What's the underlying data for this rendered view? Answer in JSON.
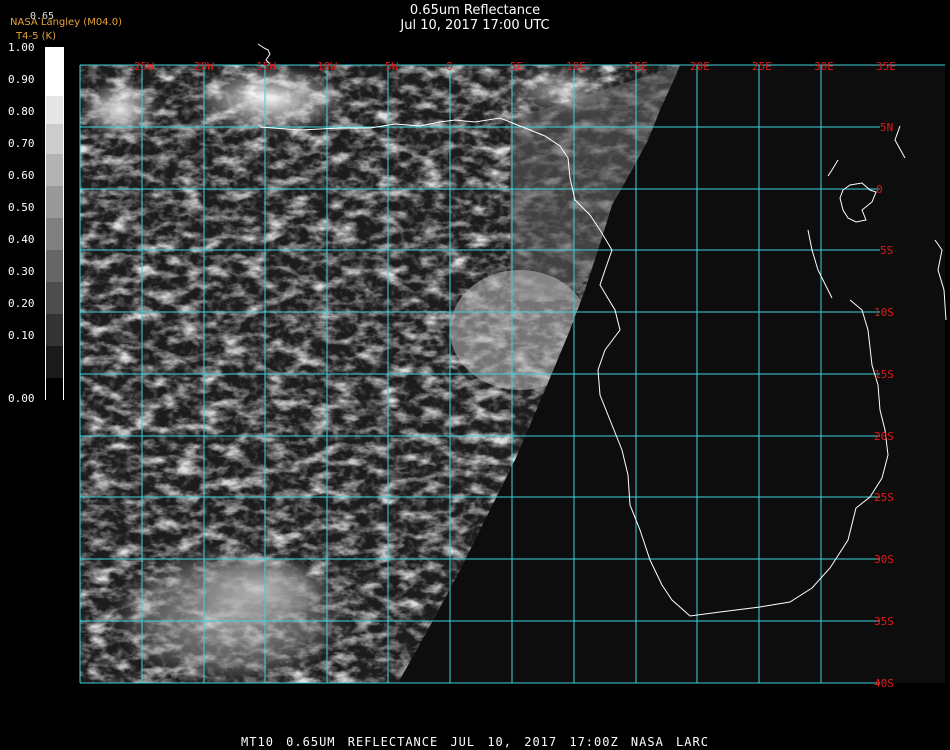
{
  "header": {
    "title": "0.65um Reflectance",
    "subtitle": "Jul 10, 2017 17:00 UTC",
    "credit_line1": "NASA Langley (M04.0)",
    "credit_line2": "T4-5 (K)",
    "scale_max_label": "0.65"
  },
  "scale": {
    "labels": [
      "1.00",
      "0.90",
      "0.80",
      "0.70",
      "0.60",
      "0.50",
      "0.40",
      "0.30",
      "0.20",
      "0.10",
      "0.00"
    ],
    "label_color": "#ffffff"
  },
  "map": {
    "grid_color": "#3fd1d8",
    "label_color": "#e21a1a",
    "coast_color": "#ffffff",
    "lon_labels": [
      "25W",
      "20W",
      "15W",
      "10W",
      "5W",
      "0",
      "5E",
      "10E",
      "15E",
      "20E",
      "25E",
      "30E",
      "35E"
    ],
    "lat_labels": [
      "5N",
      "0",
      "5S",
      "10S",
      "15S",
      "20S",
      "25S",
      "30S",
      "35S",
      "40S"
    ]
  },
  "footer": {
    "text": "MT10  0.65UM REFLECTANCE  JUL 10, 2017 17:00Z  NASA LARC"
  }
}
